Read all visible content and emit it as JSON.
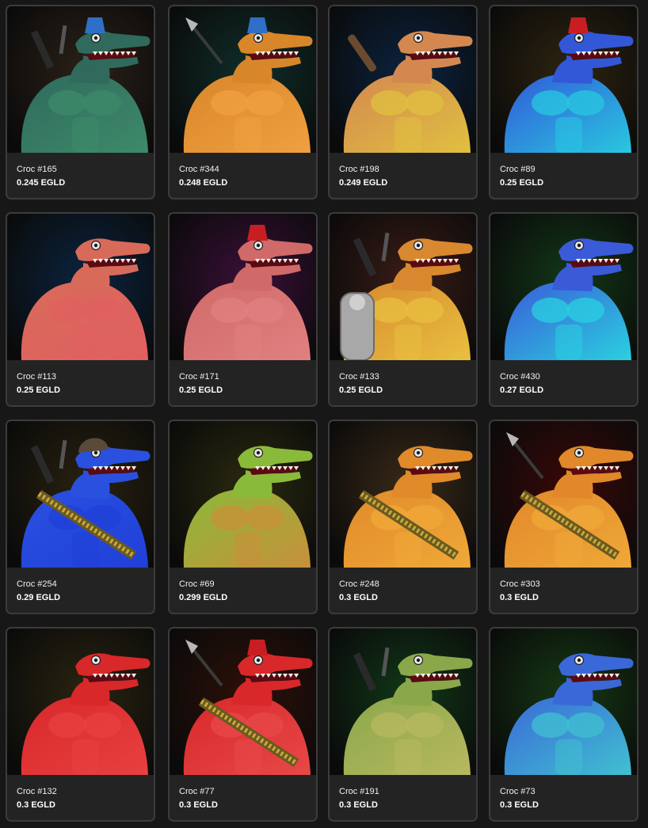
{
  "gallery": {
    "items": [
      {
        "name": "Croc #165",
        "price": "0.245 EGLD",
        "bg": "#2b2118",
        "skin": "#2f6a5c",
        "chest": "#3e8a6a",
        "accessory": "blue-fez",
        "weapon": "katana-hilt"
      },
      {
        "name": "Croc #344",
        "price": "0.248 EGLD",
        "bg": "#0f2e2a",
        "skin": "#d8862a",
        "chest": "#f0a040",
        "accessory": "blue-fez",
        "weapon": "spear"
      },
      {
        "name": "Croc #198",
        "price": "0.249 EGLD",
        "bg": "#0b2340",
        "skin": "#d48850",
        "chest": "#e0c040",
        "accessory": "none",
        "weapon": "spiked-club"
      },
      {
        "name": "Croc #89",
        "price": "0.25 EGLD",
        "bg": "#2e2410",
        "skin": "#3258d8",
        "chest": "#28c8e0",
        "accessory": "red-fez",
        "weapon": "none"
      },
      {
        "name": "Croc #113",
        "price": "0.25 EGLD",
        "bg": "#0b2440",
        "skin": "#d86a5a",
        "chest": "#e06060",
        "accessory": "none",
        "weapon": "none"
      },
      {
        "name": "Croc #171",
        "price": "0.25 EGLD",
        "bg": "#3a0f38",
        "skin": "#d06a68",
        "chest": "#e08080",
        "accessory": "red-fez",
        "weapon": "none"
      },
      {
        "name": "Croc #133",
        "price": "0.25 EGLD",
        "bg": "#3a1c16",
        "skin": "#d8882e",
        "chest": "#e8c040",
        "accessory": "robot-arm",
        "weapon": "katana-hilt"
      },
      {
        "name": "Croc #430",
        "price": "0.27 EGLD",
        "bg": "#123818",
        "skin": "#3a5ad8",
        "chest": "#2ad0e0",
        "accessory": "none",
        "weapon": "none"
      },
      {
        "name": "Croc #254",
        "price": "0.29 EGLD",
        "bg": "#2a2210",
        "skin": "#2a50e0",
        "chest": "#2040d8",
        "accessory": "helmet-ammo",
        "weapon": "katana-hilt"
      },
      {
        "name": "Croc #69",
        "price": "0.299 EGLD",
        "bg": "#2a2a10",
        "skin": "#8aba3a",
        "chest": "#c8903a",
        "accessory": "none",
        "weapon": "none"
      },
      {
        "name": "Croc #248",
        "price": "0.3 EGLD",
        "bg": "#3a2a18",
        "skin": "#e08a2a",
        "chest": "#f0a838",
        "accessory": "ammo-belt",
        "weapon": "none"
      },
      {
        "name": "Croc #303",
        "price": "0.3 EGLD",
        "bg": "#3a0808",
        "skin": "#e0882a",
        "chest": "#f0a838",
        "accessory": "ammo-belt",
        "weapon": "spear"
      },
      {
        "name": "Croc #132",
        "price": "0.3 EGLD",
        "bg": "#2a2410",
        "skin": "#d8282a",
        "chest": "#e84040",
        "accessory": "none",
        "weapon": "none"
      },
      {
        "name": "Croc #77",
        "price": "0.3 EGLD",
        "bg": "#2e1008",
        "skin": "#d8282a",
        "chest": "#e84848",
        "accessory": "red-fez-ammo",
        "weapon": "spear"
      },
      {
        "name": "Croc #191",
        "price": "0.3 EGLD",
        "bg": "#113818",
        "skin": "#8aa84a",
        "chest": "#b8b860",
        "accessory": "none",
        "weapon": "katana-hilt"
      },
      {
        "name": "Croc #73",
        "price": "0.3 EGLD",
        "bg": "#153a14",
        "skin": "#3a68d8",
        "chest": "#40c0d0",
        "accessory": "none",
        "weapon": "none"
      }
    ]
  }
}
